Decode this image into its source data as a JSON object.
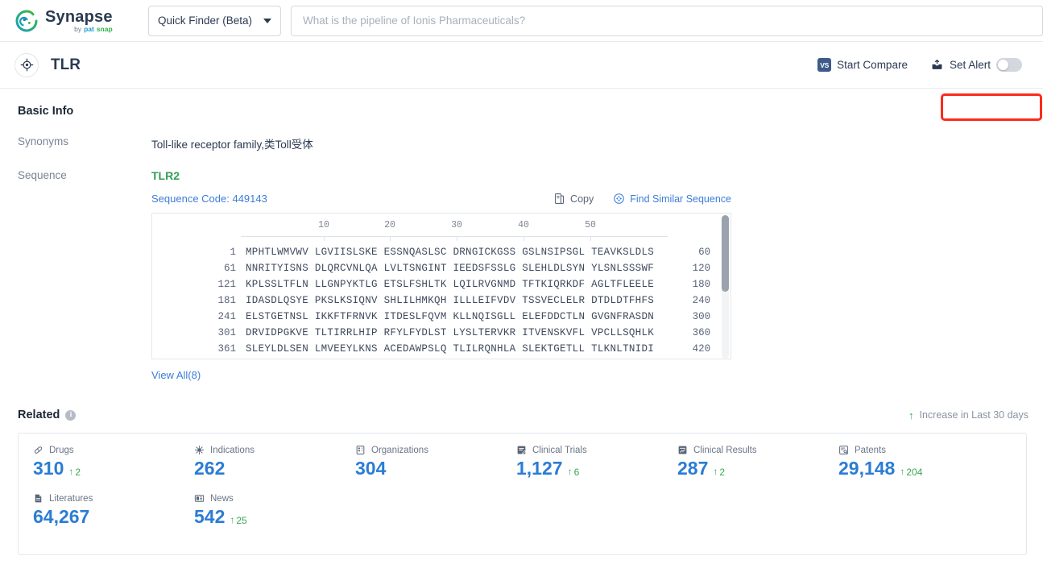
{
  "brand": {
    "name": "Synapse",
    "by": "by",
    "pat": "pat",
    "snap": "snap",
    "logo_icon": "synapse-swirl-logo",
    "colors": {
      "teal": "#1aa3b5",
      "green": "#3cb54a",
      "blue": "#1a9ad6"
    }
  },
  "topbar": {
    "finder_label": "Quick Finder (Beta)",
    "finder_caret_icon": "chevron-down-icon",
    "search_value": "",
    "search_placeholder": "What is the pipeline of Ionis Pharmaceuticals?"
  },
  "title_row": {
    "entity_icon": "target-crosshair-icon",
    "entity_name": "TLR",
    "start_compare_label": "Start Compare",
    "vs_badge": "VS",
    "set_alert_label": "Set Alert",
    "set_alert_icon": "alert-inbox-icon",
    "alert_toggle_state": "off",
    "highlight_color": "#fb2b1c"
  },
  "basic_info": {
    "heading": "Basic Info",
    "fields": [
      {
        "label": "Synonyms",
        "value": "Toll-like receptor family,类Toll受体"
      },
      {
        "label": "Sequence",
        "value": ""
      }
    ],
    "sequence": {
      "name": "TLR2",
      "code_label": "Sequence Code: 449143",
      "copy_label": "Copy",
      "copy_icon": "copy-icon",
      "similar_label": "Find Similar Sequence",
      "similar_icon": "find-similar-sequence-icon",
      "ruler_ticks": [
        "10",
        "20",
        "30",
        "40",
        "50"
      ],
      "rows": [
        {
          "start": "1",
          "chunks": "MPHTLWMVWV LGVIISLSKE ESSNQASLSC DRNGICKGSS GSLNSIPSGL TEAVKSLDLS",
          "end": "60"
        },
        {
          "start": "61",
          "chunks": "NNRITYISNS DLQRCVNLQA LVLTSNGINT IEEDSFSSLG SLEHLDLSYN YLSNLSSSWF",
          "end": "120"
        },
        {
          "start": "121",
          "chunks": "KPLSSLTFLN LLGNPYKTLG ETSLFSHLTK LQILRVGNMD TFTKIQRKDF AGLTFLEELE",
          "end": "180"
        },
        {
          "start": "181",
          "chunks": "IDASDLQSYE PKSLKSIQNV SHLILHMKQH ILLLEIFVDV TSSVECLELR DTDLDTFHFS",
          "end": "240"
        },
        {
          "start": "241",
          "chunks": "ELSTGETNSL IKKFTFRNVK ITDESLFQVM KLLNQISGLL ELEFDDCTLN GVGNFRASDN",
          "end": "300"
        },
        {
          "start": "301",
          "chunks": "DRVIDPGKVE TLTIRRLHIP RFYLFYDLST LYSLTERVKR ITVENSKVFL VPCLLSQHLK",
          "end": "360"
        },
        {
          "start": "361",
          "chunks": "SLEYLDLSEN LMVEEYLKNS ACEDAWPSLQ TLILRQNHLA SLEKTGETLL TLKNLTNIDI",
          "end": "420"
        }
      ],
      "view_all_label": "View All(8)"
    }
  },
  "related": {
    "heading": "Related",
    "info_icon": "info-icon",
    "increase_note": "Increase in Last 30 days",
    "increase_arrow_icon": "arrow-up-icon",
    "stats": [
      {
        "label": "Drugs",
        "icon": "pill-icon",
        "value": "310",
        "delta": "2"
      },
      {
        "label": "Indications",
        "icon": "virus-icon",
        "value": "262",
        "delta": ""
      },
      {
        "label": "Organizations",
        "icon": "building-icon",
        "value": "304",
        "delta": ""
      },
      {
        "label": "Clinical Trials",
        "icon": "clinical-trial-icon",
        "value": "1,127",
        "delta": "6"
      },
      {
        "label": "Clinical Results",
        "icon": "clinical-result-icon",
        "value": "287",
        "delta": "2"
      },
      {
        "label": "Patents",
        "icon": "patent-icon",
        "value": "29,148",
        "delta": "204"
      },
      {
        "label": "Literatures",
        "icon": "literature-icon",
        "value": "64,267",
        "delta": ""
      },
      {
        "label": "News",
        "icon": "news-icon",
        "value": "542",
        "delta": "25"
      }
    ]
  }
}
